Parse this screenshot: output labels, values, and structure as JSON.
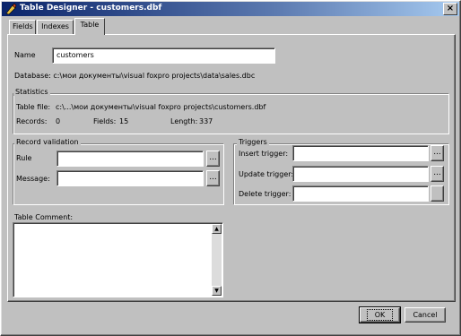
{
  "window": {
    "title": "Table Designer - customers.dbf",
    "close_glyph": "×"
  },
  "tabs": [
    {
      "label": "Fields",
      "active": false
    },
    {
      "label": "Indexes",
      "active": false
    },
    {
      "label": "Table",
      "active": true
    }
  ],
  "table": {
    "name_label": "Name",
    "name_value": "customers",
    "database_line": "Database: c:\\мои документы\\visual foxpro projects\\data\\sales.dbc"
  },
  "statistics": {
    "title": "Statistics",
    "table_file_label": "Table file:",
    "table_file_value": "c:\\...\\мои документы\\visual foxpro projects\\customers.dbf",
    "records_label": "Records:",
    "records_value": "0",
    "fields_label": "Fields:",
    "fields_value": "15",
    "length_label": "Length:",
    "length_value": "337"
  },
  "record_validation": {
    "title": "Record validation",
    "rule_label": "Rule",
    "rule_value": "",
    "message_label": "Message:",
    "message_value": "",
    "ellipsis": "..."
  },
  "triggers": {
    "title": "Triggers",
    "insert_label": "Insert trigger:",
    "insert_value": "",
    "update_label": "Update trigger:",
    "update_value": "",
    "delete_label": "Delete trigger:",
    "delete_value": "",
    "ellipsis": "..."
  },
  "comment": {
    "label": "Table Comment:",
    "value": ""
  },
  "buttons": {
    "ok": "OK",
    "cancel": "Cancel"
  },
  "icons": {
    "window_icon": "table-designer-icon",
    "scroll_up": "▲",
    "scroll_down": "▼"
  }
}
